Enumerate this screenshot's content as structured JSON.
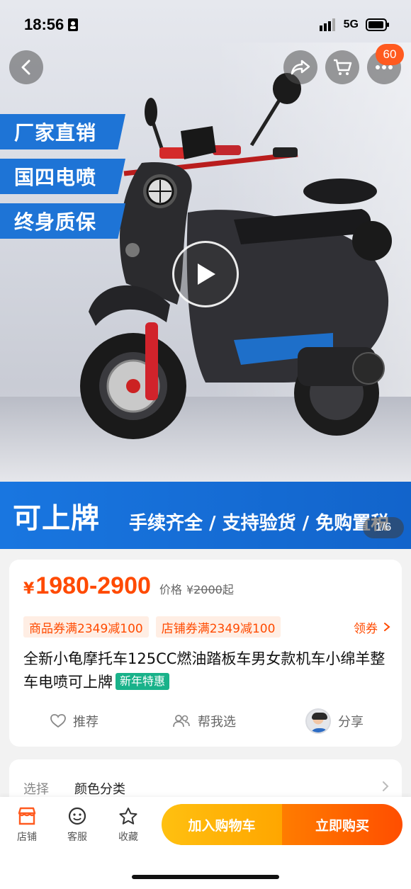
{
  "status_bar": {
    "time": "18:56",
    "network": "5G"
  },
  "nav": {
    "cart_badge": "60"
  },
  "hero": {
    "promo_tags": [
      "厂家直销",
      "国四电喷",
      "终身质保"
    ],
    "banner_main": "可上牌",
    "banner_sub": "手续齐全 / 支持验货 / 免购置税",
    "image_counter": "1/6"
  },
  "price": {
    "symbol": "¥",
    "range": "1980-2900",
    "orig_label": "价格",
    "orig_symbol": "¥",
    "orig_value": "2000",
    "orig_suffix": "起"
  },
  "coupons": {
    "product_coupon": "商品券满2349减100",
    "store_coupon": "店铺券满2349减100",
    "claim": "领券"
  },
  "product": {
    "title": "全新小龟摩托车125CC燃油踏板车男女款机车小绵羊整车电喷可上牌",
    "badge": "新年特惠"
  },
  "actions": {
    "recommend": "推荐",
    "help_choose": "帮我选",
    "share": "分享"
  },
  "spec": {
    "label": "选择",
    "value": "颜色分类"
  },
  "bottom_bar": {
    "store": "店铺",
    "service": "客服",
    "favorite": "收藏",
    "add_to_cart": "加入购物车",
    "buy_now": "立即购买"
  },
  "colors": {
    "accent": "#ff4a00",
    "brand_blue": "#1e74d6",
    "cart_yellow": "#ffb000",
    "badge_green": "#19b28a"
  }
}
